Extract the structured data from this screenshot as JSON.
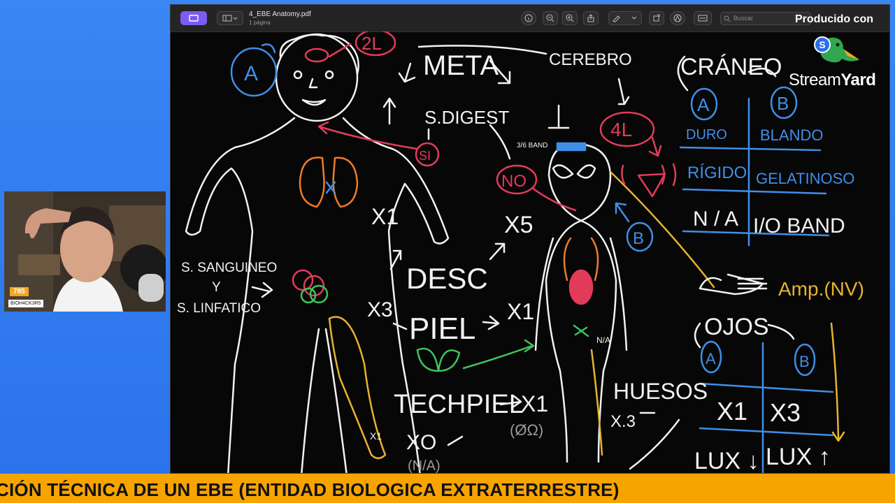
{
  "pdf_viewer": {
    "document_name": "4_EBE Anatomy.pdf",
    "page_count": "1 página",
    "search_placeholder": "Buscar"
  },
  "overlay": {
    "produced_with": "Producido con",
    "brand_part1": "Stream",
    "brand_part2": "Yard",
    "logo_letter": "S"
  },
  "webcam": {
    "viewer_count": "785",
    "channel": "BIOH4CK3R5"
  },
  "banner": {
    "text": "CIÓN TÉCNICA DE UN EBE (ENTIDAD BIOLOGICA EXTRATERRESTRE)"
  },
  "whiteboard": {
    "label_a_top": "A",
    "label_2l": "2L",
    "meta": "META",
    "cerebro": "CEREBRO",
    "s_digest": "S.DIGEST",
    "si": "SI",
    "no": "NO",
    "band_small": "3/6 BAND",
    "label_4l": "4L",
    "x1_body": "X1",
    "x5": "X5",
    "label_b_mid": "B",
    "s_sanguineo": "S. SANGUINEO",
    "y_conj": "Y",
    "s_linfatico": "S. LINFATICO",
    "desc": "DESC",
    "x3_piel": "X3",
    "piel": "PIEL",
    "x1_piel": "X1",
    "techpiel": "TECHPIEL",
    "x1_tech": "X1",
    "omega": "(ØΩ)",
    "x0": "XO",
    "na_small": "(N/A)",
    "x1_leg": "X1",
    "na_diag": "N/A",
    "huesos": "HUESOS",
    "x3_huesos": "X.3",
    "amp_nv": "Amp.(NV)",
    "craneo": {
      "title": "CRÁNEO",
      "col_a": "A",
      "col_b": "B",
      "rows": [
        [
          "DURO",
          "BLANDO"
        ],
        [
          "RÍGIDO",
          "GELATINOSO"
        ],
        [
          "N / A",
          "I/O BAND"
        ]
      ]
    },
    "ojos": {
      "title": "OJOS",
      "col_a": "A",
      "col_b": "B",
      "rows": [
        [
          "X1",
          "X3"
        ],
        [
          "LUX ↓",
          "LUX ↑"
        ]
      ]
    }
  },
  "colors": {
    "chalk_white": "#f2f2f2",
    "blue": "#3f8fe8",
    "red": "#e23b5a",
    "orange": "#f07a2a",
    "yellow": "#e9b22f",
    "green": "#3fc35b",
    "banner": "#f7a400"
  }
}
